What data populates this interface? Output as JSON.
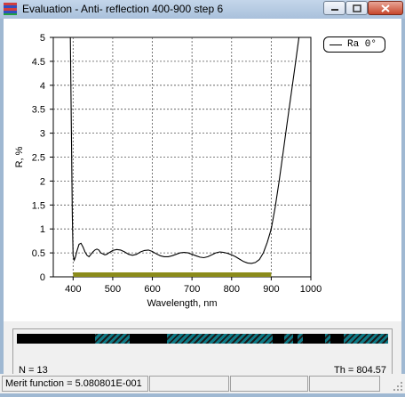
{
  "window": {
    "title": "Evaluation - Anti- reflection 400-900 step 6",
    "controls": [
      "minimize",
      "maximize",
      "close"
    ]
  },
  "chart_data": {
    "type": "line",
    "xlabel": "Wavelength, nm",
    "ylabel": "R, %",
    "xlim": [
      350,
      1000
    ],
    "ylim": [
      0,
      5
    ],
    "x_ticks": [
      "400",
      "500",
      "600",
      "700",
      "800",
      "900",
      "1000"
    ],
    "y_ticks": [
      "0",
      "0.5",
      "1",
      "1.5",
      "2",
      "2.5",
      "3",
      "3.5",
      "4",
      "4.5",
      "5"
    ],
    "grid": true,
    "legend_position": "top-right",
    "target_band": {
      "from": 400,
      "to": 900
    },
    "series": [
      {
        "name": "Ra 0°",
        "color": "#000000",
        "x": [
          393,
          395,
          397,
          398,
          399,
          400,
          403,
          406,
          410,
          415,
          420,
          425,
          430,
          435,
          440,
          450,
          455,
          460,
          465,
          470,
          480,
          485,
          490,
          500,
          510,
          520,
          530,
          540,
          550,
          560,
          570,
          580,
          590,
          600,
          610,
          620,
          630,
          640,
          650,
          660,
          670,
          680,
          690,
          700,
          710,
          720,
          730,
          740,
          750,
          760,
          770,
          780,
          790,
          800,
          810,
          820,
          830,
          840,
          850,
          860,
          870,
          880,
          890,
          900,
          910,
          920,
          930,
          940,
          950,
          960,
          970
        ],
        "y": [
          5.0,
          3.5,
          2.0,
          1.3,
          0.8,
          0.45,
          0.35,
          0.42,
          0.55,
          0.68,
          0.7,
          0.62,
          0.52,
          0.45,
          0.42,
          0.52,
          0.56,
          0.58,
          0.56,
          0.5,
          0.46,
          0.47,
          0.5,
          0.55,
          0.57,
          0.56,
          0.52,
          0.47,
          0.45,
          0.47,
          0.52,
          0.55,
          0.56,
          0.53,
          0.48,
          0.44,
          0.42,
          0.42,
          0.44,
          0.47,
          0.5,
          0.51,
          0.5,
          0.47,
          0.44,
          0.41,
          0.4,
          0.42,
          0.46,
          0.5,
          0.52,
          0.51,
          0.49,
          0.46,
          0.42,
          0.37,
          0.32,
          0.29,
          0.28,
          0.3,
          0.36,
          0.5,
          0.72,
          1.0,
          1.45,
          2.0,
          2.6,
          3.2,
          3.8,
          4.4,
          5.0
        ]
      }
    ]
  },
  "thickness_strip": {
    "blocks": [
      {
        "from": 0.0,
        "to": 0.21
      },
      {
        "from": 0.305,
        "to": 0.405
      },
      {
        "from": 0.69,
        "to": 0.72
      },
      {
        "from": 0.745,
        "to": 0.755
      },
      {
        "from": 0.77,
        "to": 0.83
      },
      {
        "from": 0.845,
        "to": 0.88
      }
    ],
    "n_label": "N = 13",
    "th_label": "Th = 804.57"
  },
  "statusbar": {
    "merit_function": "Merit function =  5.080801E-001"
  }
}
